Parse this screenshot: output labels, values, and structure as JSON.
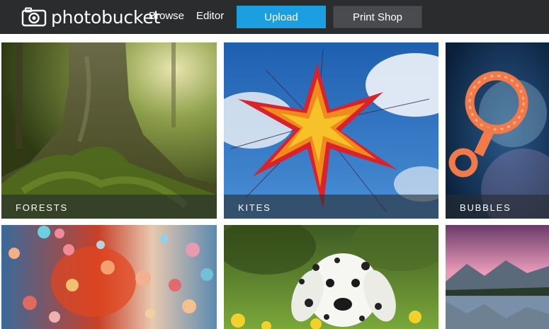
{
  "header": {
    "logo_text": "photobucket",
    "nav": [
      {
        "label": "Browse"
      },
      {
        "label": "Editor"
      }
    ],
    "upload_label": "Upload",
    "print_shop_label": "Print Shop",
    "colors": {
      "bar": "#2b2c2e",
      "upload": "#1c9fe0",
      "print_shop": "#4a4b4e"
    }
  },
  "gallery": {
    "tiles": [
      {
        "label": "FORESTS",
        "image": "mossy-tree-roots"
      },
      {
        "label": "KITES",
        "image": "star-kite-sky"
      },
      {
        "label": "BUBBLES",
        "image": "bubble-wand"
      },
      {
        "label": "",
        "image": "bokeh-raindrops"
      },
      {
        "label": "",
        "image": "dalmatian-puppy"
      },
      {
        "label": "",
        "image": "mountain-lake-sunset"
      }
    ]
  }
}
